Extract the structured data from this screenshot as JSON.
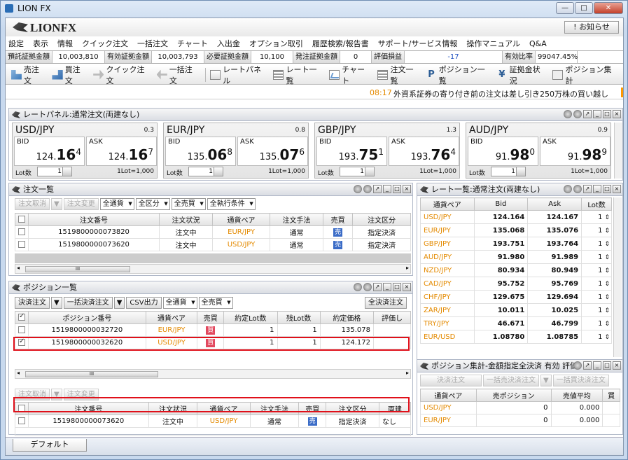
{
  "window": {
    "title": "LION FX"
  },
  "logo": "LIONFX",
  "notice_label": "! お知らせ",
  "menu": [
    "設定",
    "表示",
    "情報",
    "クイック注文",
    "一括注文",
    "チャート",
    "入出金",
    "オプション取引",
    "履歴検索/報告書",
    "サポート/サービス情報",
    "操作マニュアル",
    "Q&A"
  ],
  "account": [
    {
      "label": "預託証拠金額",
      "value": "10,003,810"
    },
    {
      "label": "有効証拠金額",
      "value": "10,003,793"
    },
    {
      "label": "必要証拠金額",
      "value": "10,100"
    },
    {
      "label": "発注証拠金額",
      "value": "0"
    },
    {
      "label": "評価損益",
      "value": "-17"
    },
    {
      "label": "有効比率",
      "value": "99047.45%"
    }
  ],
  "toolbar": [
    "売注文",
    "買注文",
    "クイック注文",
    "一括注文",
    "レートパネル",
    "レート一覧",
    "チャート",
    "注文一覧",
    "ポジション一覧",
    "証拠金状況",
    "ポジション集計"
  ],
  "ticker": {
    "time": "08:17",
    "message": "外資系証券の寄り付き前の注文は差し引き250万株の買い越し"
  },
  "rate_panel": {
    "title": "レートパネル:通常注文(両建なし)",
    "cells": [
      {
        "sym": "USD/JPY",
        "spread": "0.3",
        "bid_label": "BID",
        "ask_label": "ASK",
        "bid_a": "124.",
        "bid_b": "16",
        "bid_c": "4",
        "ask_a": "124.",
        "ask_b": "16",
        "ask_c": "7",
        "lot_label": "Lot数",
        "lot": "1",
        "lot_unit": "1Lot=1,000"
      },
      {
        "sym": "EUR/JPY",
        "spread": "0.8",
        "bid_label": "BID",
        "ask_label": "ASK",
        "bid_a": "135.",
        "bid_b": "06",
        "bid_c": "8",
        "ask_a": "135.",
        "ask_b": "07",
        "ask_c": "6",
        "lot_label": "Lot数",
        "lot": "1",
        "lot_unit": "1Lot=1,000"
      },
      {
        "sym": "GBP/JPY",
        "spread": "1.3",
        "bid_label": "BID",
        "ask_label": "ASK",
        "bid_a": "193.",
        "bid_b": "75",
        "bid_c": "1",
        "ask_a": "193.",
        "ask_b": "76",
        "ask_c": "4",
        "lot_label": "Lot数",
        "lot": "1",
        "lot_unit": "1Lot=1,000"
      },
      {
        "sym": "AUD/JPY",
        "spread": "0.9",
        "bid_label": "BID",
        "ask_label": "ASK",
        "bid_a": "91.",
        "bid_b": "98",
        "bid_c": "0",
        "ask_a": "91.",
        "ask_b": "98",
        "ask_c": "9",
        "lot_label": "Lot数",
        "lot": "1",
        "lot_unit": "1Lot=1,000"
      }
    ]
  },
  "orders": {
    "title": "注文一覧",
    "buttons": [
      "注文取消",
      "注文変更"
    ],
    "filters": [
      "全通貨",
      "全区分",
      "全売買",
      "全執行条件"
    ],
    "headers": [
      "注文番号",
      "注文状況",
      "通貨ペア",
      "注文手法",
      "売買",
      "注文区分"
    ],
    "rows": [
      {
        "id": "1519800000073820",
        "status": "注文中",
        "pair": "EUR/JPY",
        "method": "通常",
        "side": "売",
        "type": "指定決済"
      },
      {
        "id": "1519800000073620",
        "status": "注文中",
        "pair": "USD/JPY",
        "method": "通常",
        "side": "売",
        "type": "指定決済"
      }
    ]
  },
  "positions": {
    "title": "ポジション一覧",
    "buttons": [
      "決済注文",
      "一括決済注文",
      "CSV出力"
    ],
    "filters": [
      "全通貨",
      "全売買"
    ],
    "settle_all": "全決済注文",
    "headers": [
      "ポジション番号",
      "通貨ペア",
      "売買",
      "約定Lot数",
      "残Lot数",
      "約定価格",
      "評価し"
    ],
    "rows": [
      {
        "id": "1519800000032720",
        "pair": "EUR/JPY",
        "side": "買",
        "lot": "1",
        "rem": "1",
        "price": "135.078"
      },
      {
        "id": "1519800000032620",
        "pair": "USD/JPY",
        "side": "買",
        "lot": "1",
        "rem": "1",
        "price": "124.172"
      }
    ]
  },
  "sub_orders": {
    "buttons": [
      "注文取消",
      "注文変更"
    ],
    "headers": [
      "注文番号",
      "注文状況",
      "通貨ペア",
      "注文手法",
      "売買",
      "注文区分",
      "両建"
    ],
    "rows": [
      {
        "id": "1519800000073620",
        "status": "注文中",
        "pair": "USD/JPY",
        "method": "通常",
        "side": "売",
        "type": "指定決済",
        "extra": "なし"
      }
    ]
  },
  "rate_list": {
    "title": "レート一覧:通常注文(両建なし)",
    "headers": [
      "通貨ペア",
      "Bid",
      "Ask",
      "Lot数"
    ],
    "rows": [
      {
        "pair": "USD/JPY",
        "bid": "124.164",
        "ask": "124.167",
        "lot": "1"
      },
      {
        "pair": "EUR/JPY",
        "bid": "135.068",
        "ask": "135.076",
        "lot": "1"
      },
      {
        "pair": "GBP/JPY",
        "bid": "193.751",
        "ask": "193.764",
        "lot": "1"
      },
      {
        "pair": "AUD/JPY",
        "bid": "91.980",
        "ask": "91.989",
        "lot": "1"
      },
      {
        "pair": "NZD/JPY",
        "bid": "80.934",
        "ask": "80.949",
        "lot": "1"
      },
      {
        "pair": "CAD/JPY",
        "bid": "95.752",
        "ask": "95.769",
        "lot": "1"
      },
      {
        "pair": "CHF/JPY",
        "bid": "129.675",
        "ask": "129.694",
        "lot": "1"
      },
      {
        "pair": "ZAR/JPY",
        "bid": "10.011",
        "ask": "10.025",
        "lot": "1"
      },
      {
        "pair": "TRY/JPY",
        "bid": "46.671",
        "ask": "46.799",
        "lot": "1"
      },
      {
        "pair": "EUR/USD",
        "bid": "1.08780",
        "ask": "1.08785",
        "lot": "1"
      }
    ]
  },
  "agg": {
    "title": "ポジション集計-金額指定全決済 有効 評価",
    "buttons": [
      "決済注文",
      "一括売決済注文",
      "一括買決済注文"
    ],
    "headers": [
      "通貨ペア",
      "売ポジション",
      "売値平均",
      "買"
    ],
    "rows": [
      {
        "pair": "USD/JPY",
        "qty": "0",
        "avg": "0.000"
      },
      {
        "pair": "EUR/JPY",
        "qty": "0",
        "avg": "0.000"
      }
    ]
  },
  "status_tab": "デフォルト",
  "scroll_grip": "III"
}
